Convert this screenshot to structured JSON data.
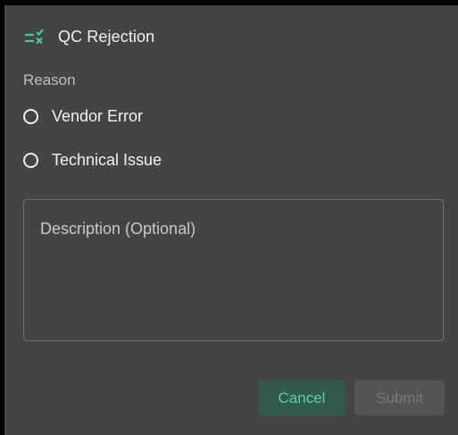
{
  "dialog": {
    "title": "QC Rejection",
    "title_icon": "list-check-x-icon",
    "accent_color": "#3ecf8e"
  },
  "reason": {
    "label": "Reason",
    "options": [
      {
        "label": "Vendor Error",
        "selected": false
      },
      {
        "label": "Technical Issue",
        "selected": false
      }
    ]
  },
  "description": {
    "placeholder": "Description (Optional)",
    "value": ""
  },
  "actions": {
    "cancel_label": "Cancel",
    "submit_label": "Submit",
    "submit_enabled": false
  }
}
